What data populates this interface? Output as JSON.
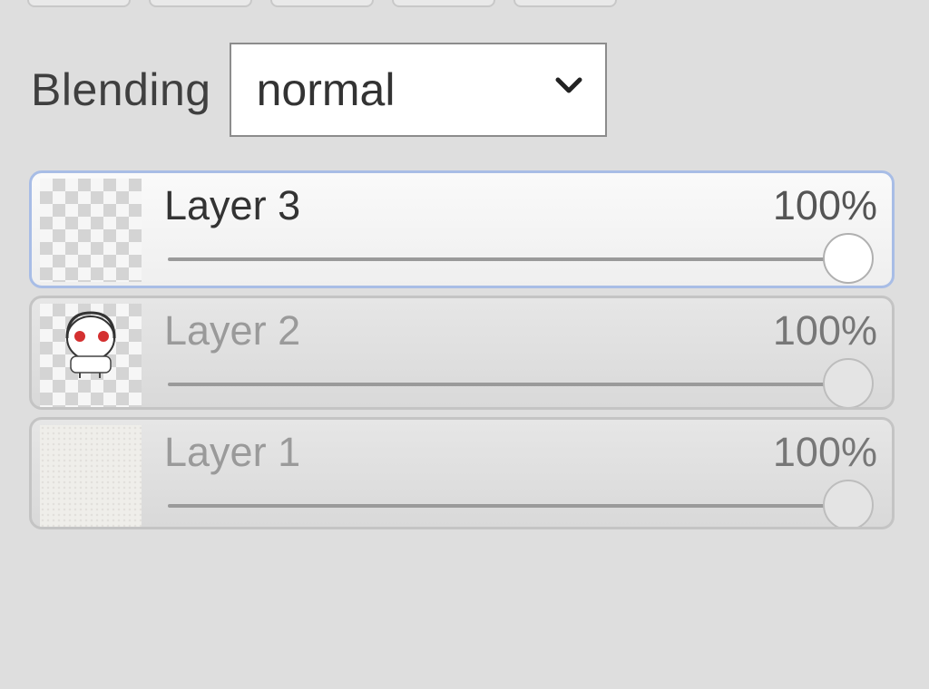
{
  "toolbar": {
    "buttons": [
      "",
      "",
      "",
      "",
      ""
    ]
  },
  "blending": {
    "label": "Blending",
    "selected": "normal",
    "icon": "chevron-down-icon"
  },
  "layers": [
    {
      "name": "Layer 3",
      "opacity_label": "100%",
      "opacity": 100,
      "selected": true,
      "thumb": "empty-transparent"
    },
    {
      "name": "Layer 2",
      "opacity_label": "100%",
      "opacity": 100,
      "selected": false,
      "thumb": "character-sketch"
    },
    {
      "name": "Layer 1",
      "opacity_label": "100%",
      "opacity": 100,
      "selected": false,
      "thumb": "paper-texture"
    }
  ],
  "colors": {
    "background": "#dedede",
    "selected_border": "#a8bde6",
    "accent_red": "#d43030"
  }
}
